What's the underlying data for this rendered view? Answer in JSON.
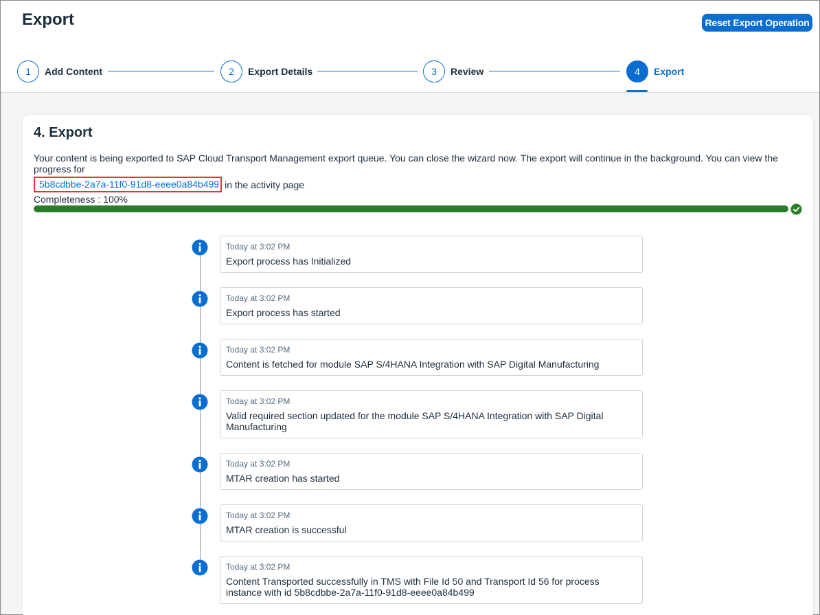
{
  "header": {
    "title": "Export",
    "reset_button": "Reset Export Operation"
  },
  "steps": [
    {
      "number": "1",
      "label": "Add Content"
    },
    {
      "number": "2",
      "label": "Export Details"
    },
    {
      "number": "3",
      "label": "Review"
    },
    {
      "number": "4",
      "label": "Export"
    }
  ],
  "export_section": {
    "title": "4. Export",
    "description": "Your content is being exported to SAP Cloud Transport Management export queue. You can close the wizard now. The export will continue in the background. You can view the progress for",
    "operation_id": "5b8cdbbe-2a7a-11f0-91d8-eeee0a84b499",
    "link_suffix": "in the activity page",
    "completeness_label": "Completeness : 100%",
    "completeness": 1.0
  },
  "timeline": [
    {
      "time": "Today at 3:02 PM",
      "text": "Export process has Initialized"
    },
    {
      "time": "Today at 3:02 PM",
      "text": "Export process has started"
    },
    {
      "time": "Today at 3:02 PM",
      "text": "Content is fetched for module SAP S/4HANA Integration with SAP Digital Manufacturing"
    },
    {
      "time": "Today at 3:02 PM",
      "text": "Valid required section updated for the module SAP S/4HANA Integration with SAP Digital Manufacturing"
    },
    {
      "time": "Today at 3:02 PM",
      "text": "MTAR creation has started"
    },
    {
      "time": "Today at 3:02 PM",
      "text": "MTAR creation is successful"
    },
    {
      "time": "Today at 3:02 PM",
      "text": "Content Transported successfully in TMS with File Id 50 and Transport Id 56 for process instance with id 5b8cdbbe-2a7a-11f0-91d8-eeee0a84b499"
    }
  ],
  "colors": {
    "accent": "#0a6ed1",
    "success": "#2b7d2b",
    "highlight_border": "#e5343a"
  },
  "icons": {
    "timeline": "info-icon",
    "progress_done": "check-circle-icon"
  }
}
